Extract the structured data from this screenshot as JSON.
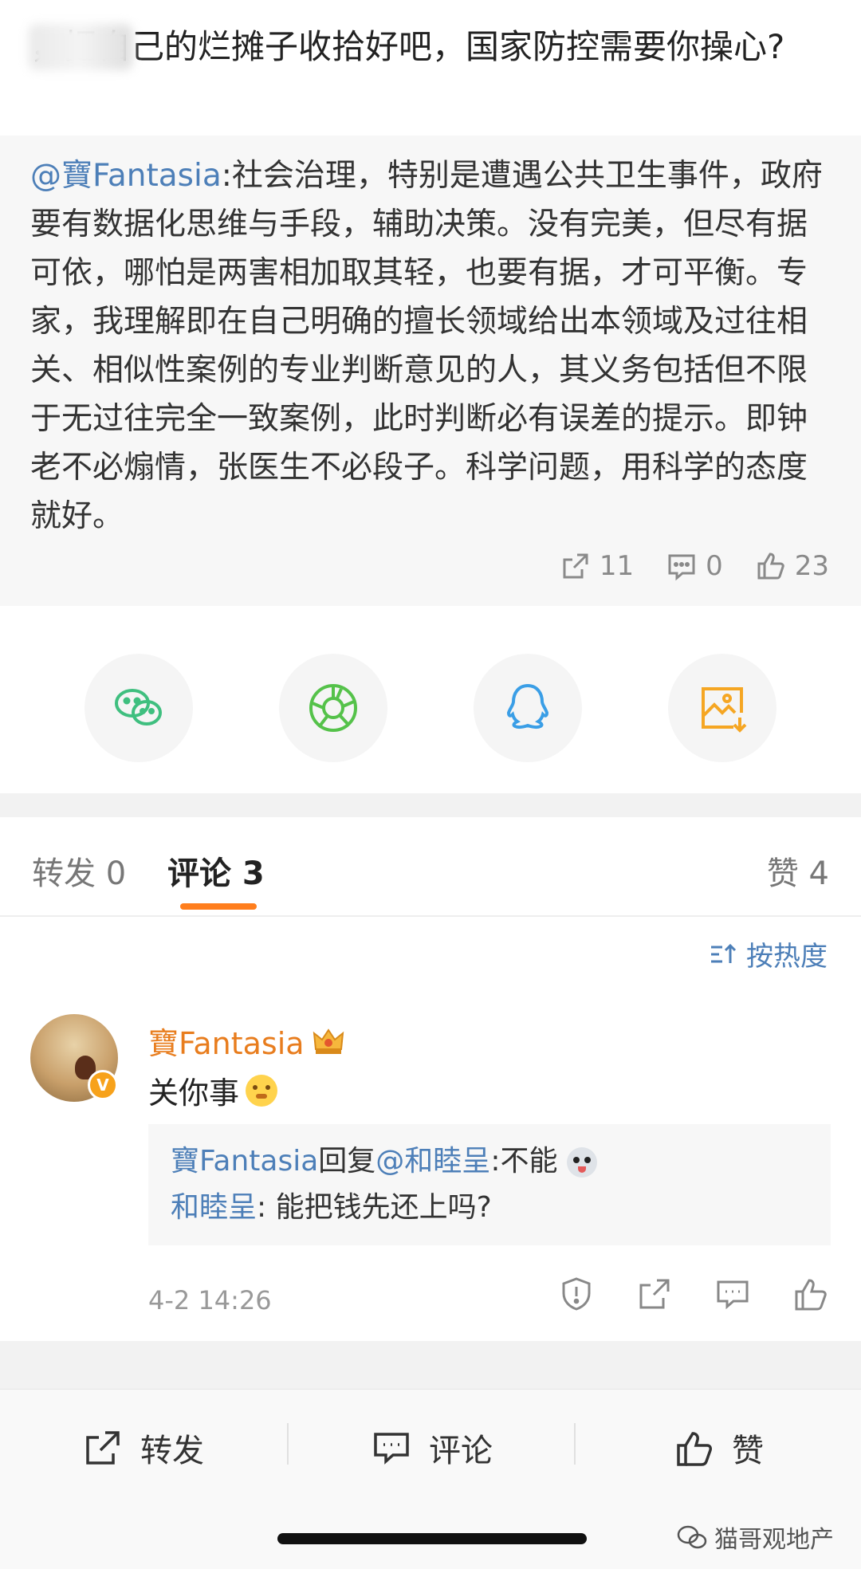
{
  "post": {
    "text": "     ，把自己的烂摊子收拾好吧，国家防控需要你操心?"
  },
  "quoted": {
    "mention": "@寶Fantasia",
    "text": ":社会治理，特别是遭遇公共卫生事件，政府要有数据化思维与手段，辅助决策。没有完美，但尽有据可依，哪怕是两害相加取其轻，也要有据，才可平衡。专家，我理解即在自己明确的擅长领域给出本领域及过往相关、相似性案例的专业判断意见的人，其义务包括但不限于无过往完全一致案例，此时判断必有误差的提示。即钟老不必煽情，张医生不必段子。科学问题，用科学的态度就好。",
    "reposts": "11",
    "comments": "0",
    "likes": "23"
  },
  "share": {
    "items": [
      "wechat-icon",
      "moments-icon",
      "qq-icon",
      "save-image-icon"
    ],
    "colors": {
      "wechat": "#3fbf7f",
      "moments": "#55c24a",
      "qq": "#3a9ee6",
      "save": "#f5a623"
    }
  },
  "tabs": {
    "repost": "转发 0",
    "comment": "评论 3",
    "like": "赞 4",
    "accent": "#ff7e1d"
  },
  "comments": {
    "sort_label": "按热度",
    "item": {
      "author": "寶Fantasia",
      "body": "关你事",
      "reply_1_author": "寶Fantasia",
      "reply_1_mid": "回复",
      "reply_1_target": "@和睦呈",
      "reply_1_text": ":不能",
      "reply_2_author": "和睦呈",
      "reply_2_text": ": 能把钱先还上吗?",
      "time": "4-2 14:26"
    }
  },
  "bottom_bar": {
    "repost": "转发",
    "comment": "评论",
    "like": "赞",
    "watermark": "猫哥观地产"
  }
}
